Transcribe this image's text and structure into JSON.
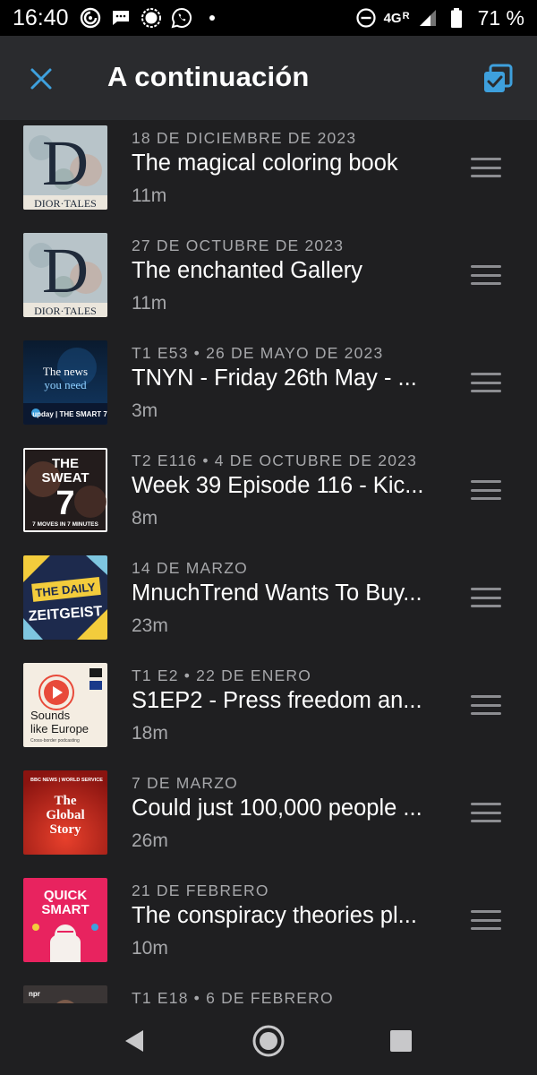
{
  "status_bar": {
    "time": "16:40",
    "network": "4G",
    "network_roaming": "R",
    "battery": "71 %",
    "icons": [
      "pocketcasts-icon",
      "messages-icon",
      "signal-icon",
      "whatsapp-icon",
      "dot-icon",
      "dnd-icon",
      "cell-signal-icon",
      "battery-icon"
    ]
  },
  "app_bar": {
    "title": "A continuación",
    "close_icon": "close-icon",
    "select_icon": "multi-select-icon",
    "accent": "#3ea0dd"
  },
  "queue": [
    {
      "meta": "18 DE DICIEMBRE DE 2023",
      "title": "The magical coloring book",
      "duration": "11m",
      "artwork": {
        "style": "dior",
        "letter": "D",
        "caption": "DIOR·TALES"
      }
    },
    {
      "meta": "27 DE OCTUBRE DE 2023",
      "title": "The enchanted Gallery",
      "duration": "11m",
      "artwork": {
        "style": "dior",
        "letter": "D",
        "caption": "DIOR·TALES"
      }
    },
    {
      "meta": "T1 E53 • 26 DE MAYO DE 2023",
      "title": "TNYN - Friday 26th May - ...",
      "duration": "3m",
      "artwork": {
        "style": "upday",
        "line1": "The news",
        "line2": "you need",
        "footer": "upday | THE SMART 7"
      }
    },
    {
      "meta": "T2 E116 • 4 DE OCTUBRE DE 2023",
      "title": "Week 39 Episode 116 - Kic...",
      "duration": "8m",
      "artwork": {
        "style": "sweat",
        "line1": "THE",
        "line2": "SWEAT",
        "line3": "7",
        "footer": "7 MOVES IN 7 MINUTES"
      }
    },
    {
      "meta": "14 DE MARZO",
      "title": "MnuchTrend Wants To Buy...",
      "duration": "23m",
      "artwork": {
        "style": "zeitgeist",
        "line1": "THE DAILY",
        "line2": "ZEITGEIST"
      }
    },
    {
      "meta": "T1 E2 • 22 DE ENERO",
      "title": "S1EP2 - Press freedom an...",
      "duration": "18m",
      "artwork": {
        "style": "europe",
        "line1": "Sounds",
        "line2": "like Europe",
        "footer": "Cross-border podcasting"
      }
    },
    {
      "meta": "7 DE MARZO",
      "title": "Could just 100,000 people ...",
      "duration": "26m",
      "artwork": {
        "style": "bbc",
        "header": "BBC NEWS | WORLD SERVICE",
        "line1": "The",
        "line2": "Global",
        "line3": "Story"
      }
    },
    {
      "meta": "21 DE FEBRERO",
      "title": "The conspiracy theories pl...",
      "duration": "10m",
      "artwork": {
        "style": "quicksmart",
        "line1": "QUICK",
        "line2": "SMART"
      }
    },
    {
      "meta": "T1 E18 • 6 DE FEBRERO",
      "title": "",
      "duration": "",
      "artwork": {
        "style": "npr",
        "header": "npr"
      }
    }
  ],
  "nav_bar": {
    "back_icon": "back-triangle-icon",
    "home_icon": "home-circle-icon",
    "recents_icon": "recents-square-icon"
  }
}
